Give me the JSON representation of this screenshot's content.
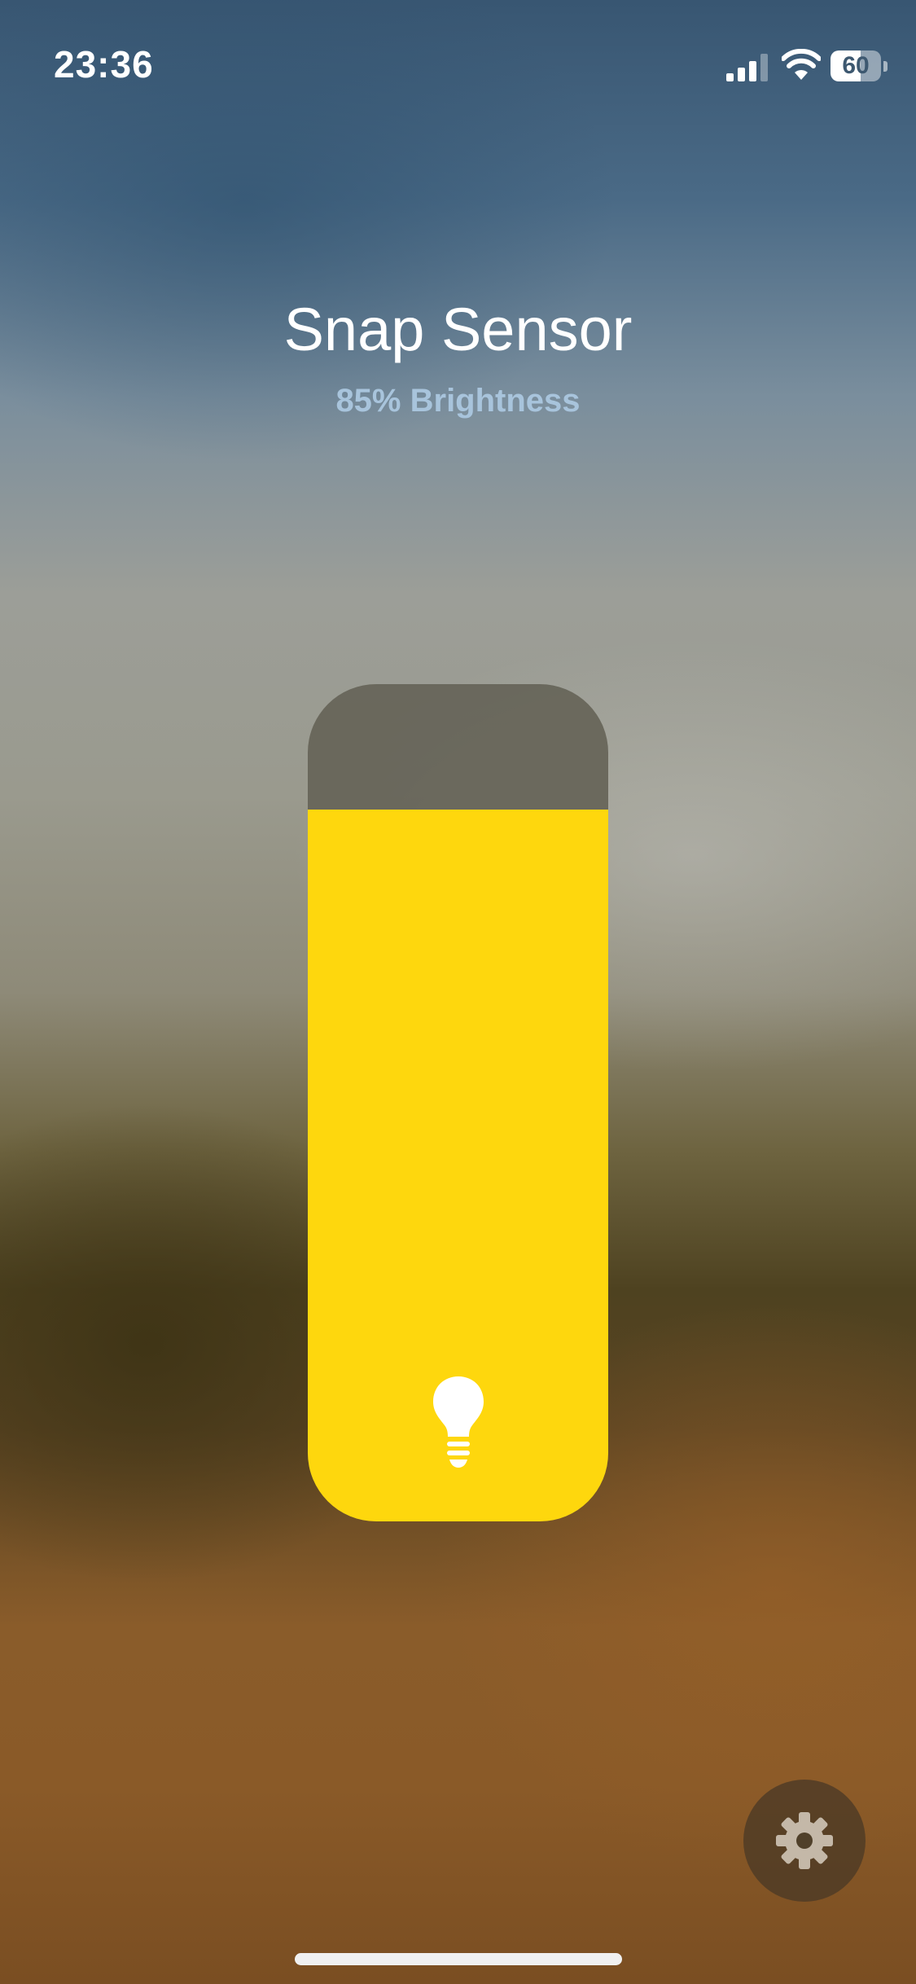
{
  "status_bar": {
    "time": "23:36",
    "signal_bars": 3,
    "signal_bars_total": 4,
    "battery_percent": 60,
    "battery_label": "60",
    "icons": [
      "signal-icon",
      "wifi-icon",
      "battery-icon"
    ]
  },
  "header": {
    "title": "Snap Sensor",
    "subtitle": "85% Brightness"
  },
  "brightness_slider": {
    "value_percent": 85,
    "fill_color": "#fed70d",
    "track_color": "#666458",
    "icon": "lightbulb-icon"
  },
  "settings": {
    "icon": "gear-icon"
  },
  "colors": {
    "accent": "#fed70d",
    "subtitle": "#a8c4dc",
    "text": "#ffffff"
  }
}
